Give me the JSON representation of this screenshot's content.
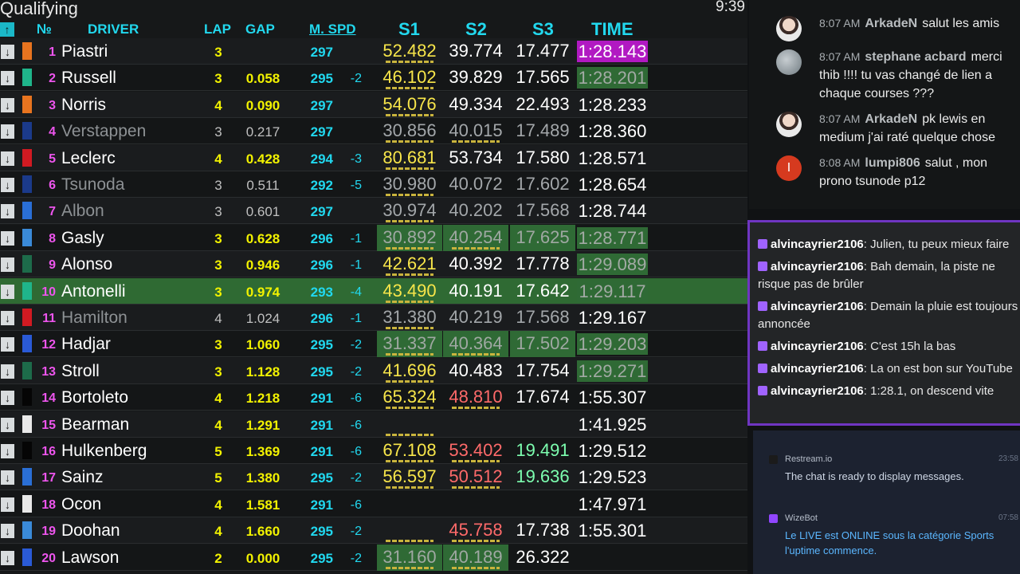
{
  "header": {
    "session": "Qualifying",
    "clock": "9:39",
    "sort_icon": "arrow-up-icon",
    "cols": {
      "pos": "№",
      "driver": "DRIVER",
      "lap": "LAP",
      "gap": "GAP",
      "mspd": "M. SPD",
      "s1": "S1",
      "s2": "S2",
      "s3": "S3",
      "time": "TIME"
    }
  },
  "colors": {
    "accent": "#22d8ee",
    "purple_best": "#b119c2",
    "green_best": "#2c7a36",
    "highlight_row": "#2f6a33",
    "lap_yellow": "#f2f200",
    "chat_border": "#6f35c2"
  },
  "drivers": [
    {
      "pos": "1",
      "name": "Piastri",
      "team": "#e8741f",
      "lap": "3",
      "gap": "",
      "spd": "297",
      "spdd": "",
      "s1": "52.482",
      "s2": "39.774",
      "s3": "17.477",
      "time": "1:28.143"
    },
    {
      "pos": "2",
      "name": "Russell",
      "team": "#1fb58a",
      "lap": "3",
      "gap": "0.058",
      "spd": "295",
      "spdd": "-2",
      "s1": "46.102",
      "s2": "39.829",
      "s3": "17.565",
      "time": "1:28.201"
    },
    {
      "pos": "3",
      "name": "Norris",
      "team": "#e8741f",
      "lap": "4",
      "gap": "0.090",
      "spd": "297",
      "spdd": "",
      "s1": "54.076",
      "s2": "49.334",
      "s3": "22.493",
      "time": "1:28.233"
    },
    {
      "pos": "4",
      "name": "Verstappen",
      "team": "#1b3a8a",
      "lap": "3",
      "gap": "0.217",
      "spd": "297",
      "spdd": "",
      "s1": "30.856",
      "s2": "40.015",
      "s3": "17.489",
      "time": "1:28.360"
    },
    {
      "pos": "5",
      "name": "Leclerc",
      "team": "#d11a22",
      "lap": "4",
      "gap": "0.428",
      "spd": "294",
      "spdd": "-3",
      "s1": "80.681",
      "s2": "53.734",
      "s3": "17.580",
      "time": "1:28.571"
    },
    {
      "pos": "6",
      "name": "Tsunoda",
      "team": "#1b3a8a",
      "lap": "3",
      "gap": "0.511",
      "spd": "292",
      "spdd": "-5",
      "s1": "30.980",
      "s2": "40.072",
      "s3": "17.602",
      "time": "1:28.654"
    },
    {
      "pos": "7",
      "name": "Albon",
      "team": "#2a6fd6",
      "lap": "3",
      "gap": "0.601",
      "spd": "297",
      "spdd": "",
      "s1": "30.974",
      "s2": "40.202",
      "s3": "17.568",
      "time": "1:28.744"
    },
    {
      "pos": "8",
      "name": "Gasly",
      "team": "#3a8ad8",
      "lap": "3",
      "gap": "0.628",
      "spd": "296",
      "spdd": "-1",
      "s1": "30.892",
      "s2": "40.254",
      "s3": "17.625",
      "time": "1:28.771"
    },
    {
      "pos": "9",
      "name": "Alonso",
      "team": "#1d6b4a",
      "lap": "3",
      "gap": "0.946",
      "spd": "296",
      "spdd": "-1",
      "s1": "42.621",
      "s2": "40.392",
      "s3": "17.778",
      "time": "1:29.089"
    },
    {
      "pos": "10",
      "name": "Antonelli",
      "team": "#1fb58a",
      "lap": "3",
      "gap": "0.974",
      "spd": "293",
      "spdd": "-4",
      "s1": "43.490",
      "s2": "40.191",
      "s3": "17.642",
      "time": "1:29.117"
    },
    {
      "pos": "11",
      "name": "Hamilton",
      "team": "#d11a22",
      "lap": "4",
      "gap": "1.024",
      "spd": "296",
      "spdd": "-1",
      "s1": "31.380",
      "s2": "40.219",
      "s3": "17.568",
      "time": "1:29.167"
    },
    {
      "pos": "12",
      "name": "Hadjar",
      "team": "#2a5ad6",
      "lap": "3",
      "gap": "1.060",
      "spd": "295",
      "spdd": "-2",
      "s1": "31.337",
      "s2": "40.364",
      "s3": "17.502",
      "time": "1:29.203"
    },
    {
      "pos": "13",
      "name": "Stroll",
      "team": "#1d6b4a",
      "lap": "3",
      "gap": "1.128",
      "spd": "295",
      "spdd": "-2",
      "s1": "41.696",
      "s2": "40.483",
      "s3": "17.754",
      "time": "1:29.271"
    },
    {
      "pos": "14",
      "name": "Bortoleto",
      "team": "#050505",
      "lap": "4",
      "gap": "1.218",
      "spd": "291",
      "spdd": "-6",
      "s1": "65.324",
      "s2": "48.810",
      "s3": "17.674",
      "time": "1:55.307"
    },
    {
      "pos": "15",
      "name": "Bearman",
      "team": "#e9e9e9",
      "lap": "4",
      "gap": "1.291",
      "spd": "291",
      "spdd": "-6",
      "s1": "",
      "s2": "",
      "s3": "",
      "time": "1:41.925"
    },
    {
      "pos": "16",
      "name": "Hulkenberg",
      "team": "#050505",
      "lap": "5",
      "gap": "1.369",
      "spd": "291",
      "spdd": "-6",
      "s1": "67.108",
      "s2": "53.402",
      "s3": "19.491",
      "time": "1:29.512"
    },
    {
      "pos": "17",
      "name": "Sainz",
      "team": "#2a6fd6",
      "lap": "5",
      "gap": "1.380",
      "spd": "295",
      "spdd": "-2",
      "s1": "56.597",
      "s2": "50.512",
      "s3": "19.636",
      "time": "1:29.523"
    },
    {
      "pos": "18",
      "name": "Ocon",
      "team": "#e9e9e9",
      "lap": "4",
      "gap": "1.581",
      "spd": "291",
      "spdd": "-6",
      "s1": "",
      "s2": "",
      "s3": "",
      "time": "1:47.971"
    },
    {
      "pos": "19",
      "name": "Doohan",
      "team": "#3a8ad8",
      "lap": "4",
      "gap": "1.660",
      "spd": "295",
      "spdd": "-2",
      "s1": "",
      "s2": "45.758",
      "s3": "17.738",
      "time": "1:55.301"
    },
    {
      "pos": "20",
      "name": "Lawson",
      "team": "#2a5ad6",
      "lap": "2",
      "gap": "0.000",
      "spd": "295",
      "spdd": "-2",
      "s1": "31.160",
      "s2": "40.189",
      "s3": "26.322",
      "time": ""
    }
  ],
  "chat_top": [
    {
      "ts": "8:07 AM",
      "user": "ArkadeN",
      "text": "salut les amis",
      "avatar": "photo"
    },
    {
      "ts": "8:07 AM",
      "user": "stephane acbard",
      "text": "merci thib !!!! tu vas changé de lien a chaque courses ???",
      "avatar": "gray"
    },
    {
      "ts": "8:07 AM",
      "user": "ArkadeN",
      "text": "pk lewis en medium j'ai raté quelque chose",
      "avatar": "photo"
    },
    {
      "ts": "8:08 AM",
      "user": "lumpi806",
      "text": "salut , mon prono tsunode p12",
      "avatar": "red"
    }
  ],
  "chat_twitch": [
    {
      "user": "alvincayrier2106",
      "text": "Julien, tu peux mieux faire"
    },
    {
      "user": "alvincayrier2106",
      "text": "Bah demain, la piste ne risque pas de brûler"
    },
    {
      "user": "alvincayrier2106",
      "text": "Demain la pluie est toujours annoncée"
    },
    {
      "user": "alvincayrier2106",
      "text": "C'est 15h la bas"
    },
    {
      "user": "alvincayrier2106",
      "text": "La on est bon sur YouTube"
    },
    {
      "user": "alvincayrier2106",
      "text": "1:28.1, on descend vite"
    }
  ],
  "chat_bots": [
    {
      "name": "Restream.io",
      "time": "23:58",
      "text": "The chat is ready to display messages."
    },
    {
      "name": "WizeBot",
      "time": "07:58",
      "text": "Le LIVE est ONLINE sous la catégorie Sports l'uptime commence."
    }
  ]
}
